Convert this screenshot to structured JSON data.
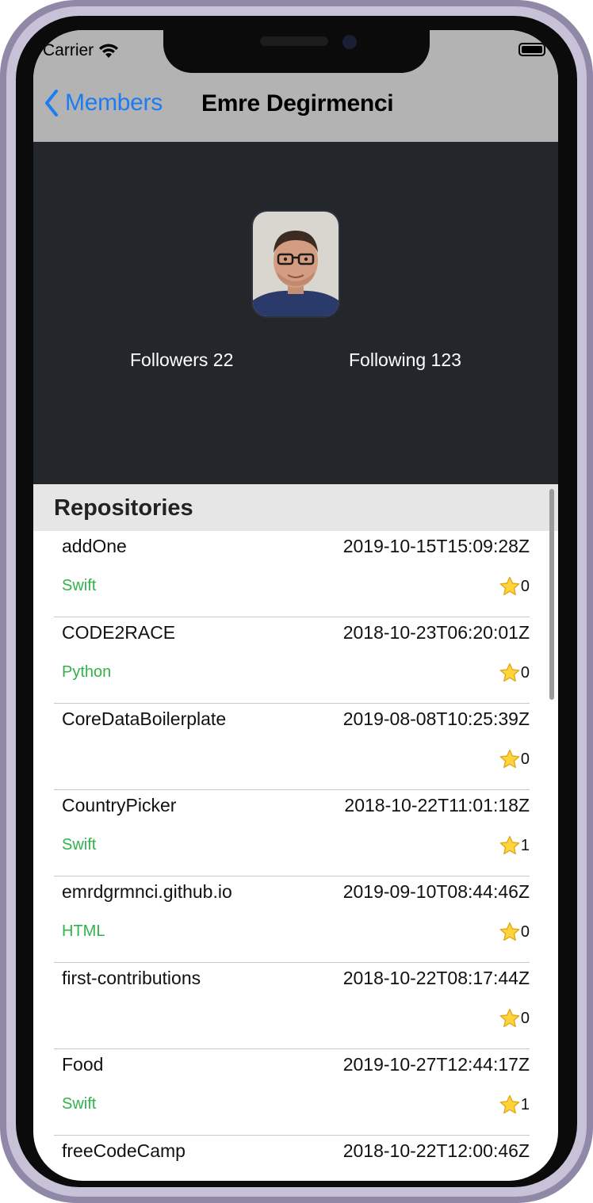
{
  "status": {
    "carrier": "Carrier"
  },
  "nav": {
    "back_label": "Members",
    "title": "Emre Degirmenci"
  },
  "profile": {
    "followers": "Followers 22",
    "following": "Following 123"
  },
  "section": {
    "title": "Repositories"
  },
  "colors": {
    "accent": "#1e7cf2",
    "language": "#2fb34a",
    "header_bg": "#23272b",
    "nav_bg": "#b3b3b3"
  },
  "repos": [
    {
      "name": "addOne",
      "date": "2019-10-15T15:09:28Z",
      "language": "Swift",
      "stars": "0"
    },
    {
      "name": "CODE2RACE",
      "date": "2018-10-23T06:20:01Z",
      "language": "Python",
      "stars": "0"
    },
    {
      "name": "CoreDataBoilerplate",
      "date": "2019-08-08T10:25:39Z",
      "language": "",
      "stars": "0"
    },
    {
      "name": "CountryPicker",
      "date": "2018-10-22T11:01:18Z",
      "language": "Swift",
      "stars": "1"
    },
    {
      "name": "emrdgrmnci.github.io",
      "date": "2019-09-10T08:44:46Z",
      "language": "HTML",
      "stars": "0"
    },
    {
      "name": "first-contributions",
      "date": "2018-10-22T08:17:44Z",
      "language": "",
      "stars": "0"
    },
    {
      "name": "Food",
      "date": "2019-10-27T12:44:17Z",
      "language": "Swift",
      "stars": "1"
    },
    {
      "name": "freeCodeCamp",
      "date": "2018-10-22T12:00:46Z",
      "language": "",
      "stars": ""
    }
  ]
}
